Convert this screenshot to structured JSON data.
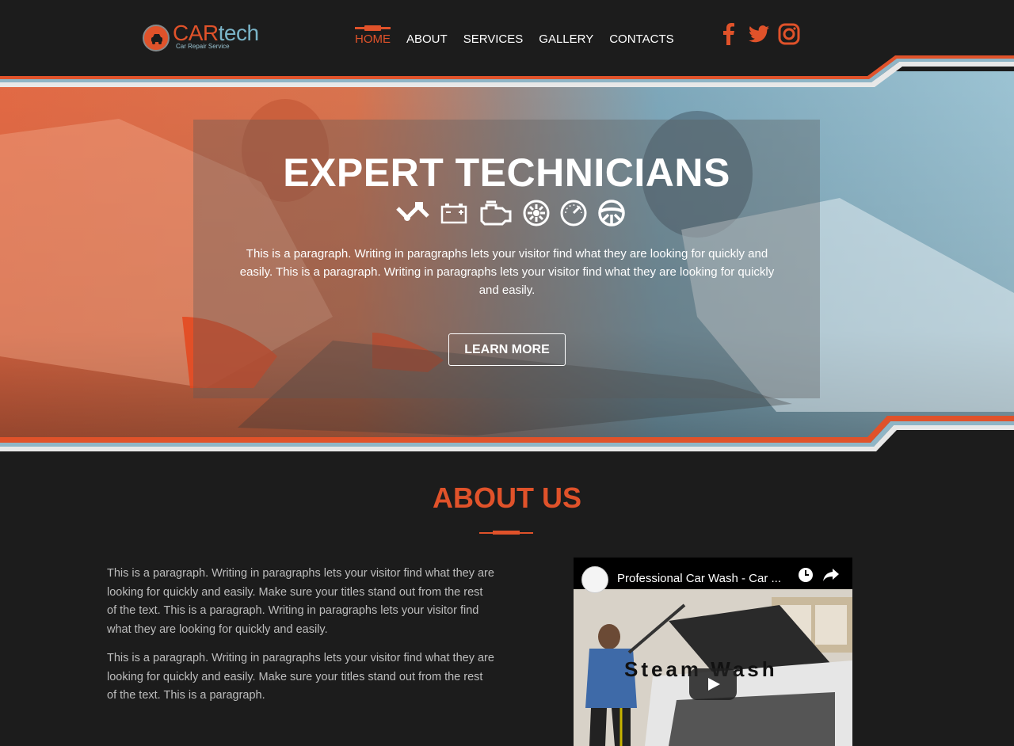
{
  "brand": {
    "name_part1": "CAR",
    "name_part2": "tech",
    "tagline": "Car Repair Service"
  },
  "nav": {
    "items": [
      {
        "label": "HOME",
        "active": true
      },
      {
        "label": "ABOUT",
        "active": false
      },
      {
        "label": "SERVICES",
        "active": false
      },
      {
        "label": "GALLERY",
        "active": false
      },
      {
        "label": "CONTACTS",
        "active": false
      }
    ]
  },
  "social": [
    "facebook-icon",
    "twitter-icon",
    "instagram-icon"
  ],
  "hero": {
    "title": "EXPERT TECHNICIANS",
    "icons": [
      "piston-icon",
      "battery-icon",
      "engine-icon",
      "fan-icon",
      "speedometer-icon",
      "steering-wheel-icon"
    ],
    "paragraph": "This is a paragraph. Writing in paragraphs lets your visitor find what they are looking for quickly and easily. This is a paragraph. Writing in paragraphs lets your visitor find what they are looking for quickly and easily.",
    "button_label": "LEARN MORE"
  },
  "about": {
    "title": "ABOUT US",
    "paragraph1": "This is a paragraph. Writing in paragraphs lets your visitor find what they are looking for quickly and easily. Make sure your titles stand out from the rest of the text. This is a paragraph. Writing in paragraphs lets your visitor find what they are looking for quickly and easily.",
    "paragraph2": "This is a paragraph. Writing in paragraphs lets your visitor find what they are looking for quickly and easily. Make sure your titles stand out from the rest of the text. This is a paragraph."
  },
  "video": {
    "title": "Professional Car Wash - Car ...",
    "caption": "Steam Wash"
  },
  "colors": {
    "accent": "#e0522a",
    "secondary": "#7ab4c8",
    "background": "#1c1c1c"
  }
}
